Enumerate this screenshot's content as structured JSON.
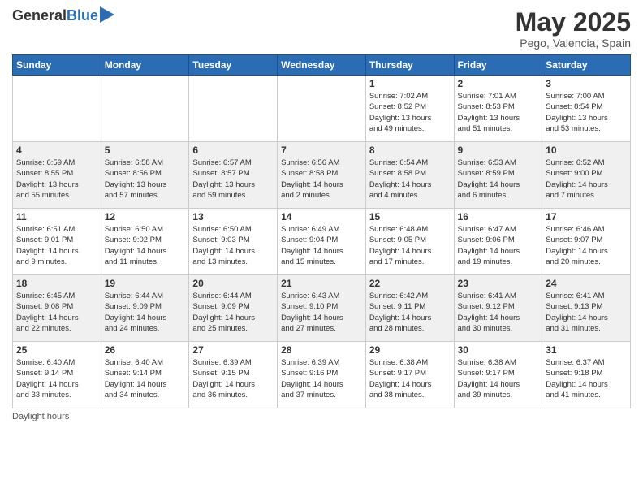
{
  "logo": {
    "general": "General",
    "blue": "Blue"
  },
  "title": "May 2025",
  "subtitle": "Pego, Valencia, Spain",
  "days_of_week": [
    "Sunday",
    "Monday",
    "Tuesday",
    "Wednesday",
    "Thursday",
    "Friday",
    "Saturday"
  ],
  "footer": "Daylight hours",
  "weeks": [
    [
      {
        "day": "",
        "info": ""
      },
      {
        "day": "",
        "info": ""
      },
      {
        "day": "",
        "info": ""
      },
      {
        "day": "",
        "info": ""
      },
      {
        "day": "1",
        "info": "Sunrise: 7:02 AM\nSunset: 8:52 PM\nDaylight: 13 hours\nand 49 minutes."
      },
      {
        "day": "2",
        "info": "Sunrise: 7:01 AM\nSunset: 8:53 PM\nDaylight: 13 hours\nand 51 minutes."
      },
      {
        "day": "3",
        "info": "Sunrise: 7:00 AM\nSunset: 8:54 PM\nDaylight: 13 hours\nand 53 minutes."
      }
    ],
    [
      {
        "day": "4",
        "info": "Sunrise: 6:59 AM\nSunset: 8:55 PM\nDaylight: 13 hours\nand 55 minutes."
      },
      {
        "day": "5",
        "info": "Sunrise: 6:58 AM\nSunset: 8:56 PM\nDaylight: 13 hours\nand 57 minutes."
      },
      {
        "day": "6",
        "info": "Sunrise: 6:57 AM\nSunset: 8:57 PM\nDaylight: 13 hours\nand 59 minutes."
      },
      {
        "day": "7",
        "info": "Sunrise: 6:56 AM\nSunset: 8:58 PM\nDaylight: 14 hours\nand 2 minutes."
      },
      {
        "day": "8",
        "info": "Sunrise: 6:54 AM\nSunset: 8:58 PM\nDaylight: 14 hours\nand 4 minutes."
      },
      {
        "day": "9",
        "info": "Sunrise: 6:53 AM\nSunset: 8:59 PM\nDaylight: 14 hours\nand 6 minutes."
      },
      {
        "day": "10",
        "info": "Sunrise: 6:52 AM\nSunset: 9:00 PM\nDaylight: 14 hours\nand 7 minutes."
      }
    ],
    [
      {
        "day": "11",
        "info": "Sunrise: 6:51 AM\nSunset: 9:01 PM\nDaylight: 14 hours\nand 9 minutes."
      },
      {
        "day": "12",
        "info": "Sunrise: 6:50 AM\nSunset: 9:02 PM\nDaylight: 14 hours\nand 11 minutes."
      },
      {
        "day": "13",
        "info": "Sunrise: 6:50 AM\nSunset: 9:03 PM\nDaylight: 14 hours\nand 13 minutes."
      },
      {
        "day": "14",
        "info": "Sunrise: 6:49 AM\nSunset: 9:04 PM\nDaylight: 14 hours\nand 15 minutes."
      },
      {
        "day": "15",
        "info": "Sunrise: 6:48 AM\nSunset: 9:05 PM\nDaylight: 14 hours\nand 17 minutes."
      },
      {
        "day": "16",
        "info": "Sunrise: 6:47 AM\nSunset: 9:06 PM\nDaylight: 14 hours\nand 19 minutes."
      },
      {
        "day": "17",
        "info": "Sunrise: 6:46 AM\nSunset: 9:07 PM\nDaylight: 14 hours\nand 20 minutes."
      }
    ],
    [
      {
        "day": "18",
        "info": "Sunrise: 6:45 AM\nSunset: 9:08 PM\nDaylight: 14 hours\nand 22 minutes."
      },
      {
        "day": "19",
        "info": "Sunrise: 6:44 AM\nSunset: 9:09 PM\nDaylight: 14 hours\nand 24 minutes."
      },
      {
        "day": "20",
        "info": "Sunrise: 6:44 AM\nSunset: 9:09 PM\nDaylight: 14 hours\nand 25 minutes."
      },
      {
        "day": "21",
        "info": "Sunrise: 6:43 AM\nSunset: 9:10 PM\nDaylight: 14 hours\nand 27 minutes."
      },
      {
        "day": "22",
        "info": "Sunrise: 6:42 AM\nSunset: 9:11 PM\nDaylight: 14 hours\nand 28 minutes."
      },
      {
        "day": "23",
        "info": "Sunrise: 6:41 AM\nSunset: 9:12 PM\nDaylight: 14 hours\nand 30 minutes."
      },
      {
        "day": "24",
        "info": "Sunrise: 6:41 AM\nSunset: 9:13 PM\nDaylight: 14 hours\nand 31 minutes."
      }
    ],
    [
      {
        "day": "25",
        "info": "Sunrise: 6:40 AM\nSunset: 9:14 PM\nDaylight: 14 hours\nand 33 minutes."
      },
      {
        "day": "26",
        "info": "Sunrise: 6:40 AM\nSunset: 9:14 PM\nDaylight: 14 hours\nand 34 minutes."
      },
      {
        "day": "27",
        "info": "Sunrise: 6:39 AM\nSunset: 9:15 PM\nDaylight: 14 hours\nand 36 minutes."
      },
      {
        "day": "28",
        "info": "Sunrise: 6:39 AM\nSunset: 9:16 PM\nDaylight: 14 hours\nand 37 minutes."
      },
      {
        "day": "29",
        "info": "Sunrise: 6:38 AM\nSunset: 9:17 PM\nDaylight: 14 hours\nand 38 minutes."
      },
      {
        "day": "30",
        "info": "Sunrise: 6:38 AM\nSunset: 9:17 PM\nDaylight: 14 hours\nand 39 minutes."
      },
      {
        "day": "31",
        "info": "Sunrise: 6:37 AM\nSunset: 9:18 PM\nDaylight: 14 hours\nand 41 minutes."
      }
    ]
  ]
}
